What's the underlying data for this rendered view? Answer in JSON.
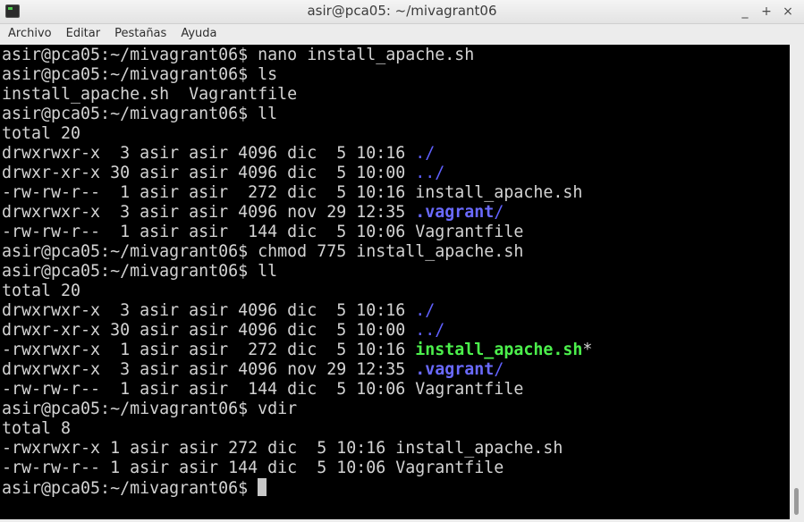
{
  "window": {
    "title": "asir@pca05: ~/mivagrant06",
    "controls": {
      "minimize": "_",
      "maximize": "+",
      "close": "×"
    }
  },
  "menu": {
    "items": [
      "Archivo",
      "Editar",
      "Pestañas",
      "Ayuda"
    ]
  },
  "terminal": {
    "lines": [
      [
        {
          "text": "asir@pca05:~/mivagrant06$ nano install_apache.sh"
        }
      ],
      [
        {
          "text": "asir@pca05:~/mivagrant06$ ls"
        }
      ],
      [
        {
          "text": "install_apache.sh  Vagrantfile"
        }
      ],
      [
        {
          "text": "asir@pca05:~/mivagrant06$ ll"
        }
      ],
      [
        {
          "text": "total 20"
        }
      ],
      [
        {
          "text": "drwxrwxr-x  3 asir asir 4096 dic  5 10:16 "
        },
        {
          "text": "./",
          "style": "blue"
        }
      ],
      [
        {
          "text": "drwxr-xr-x 30 asir asir 4096 dic  5 10:00 "
        },
        {
          "text": "../",
          "style": "blue"
        }
      ],
      [
        {
          "text": "-rw-rw-r--  1 asir asir  272 dic  5 10:16 install_apache.sh"
        }
      ],
      [
        {
          "text": "drwxrwxr-x  3 asir asir 4096 nov 29 12:35 "
        },
        {
          "text": ".vagrant",
          "style": "blue-bold"
        },
        {
          "text": "/",
          "style": "blue"
        }
      ],
      [
        {
          "text": "-rw-rw-r--  1 asir asir  144 dic  5 10:06 Vagrantfile"
        }
      ],
      [
        {
          "text": "asir@pca05:~/mivagrant06$ chmod 775 install_apache.sh"
        }
      ],
      [
        {
          "text": "asir@pca05:~/mivagrant06$ ll"
        }
      ],
      [
        {
          "text": "total 20"
        }
      ],
      [
        {
          "text": "drwxrwxr-x  3 asir asir 4096 dic  5 10:16 "
        },
        {
          "text": "./",
          "style": "blue"
        }
      ],
      [
        {
          "text": "drwxr-xr-x 30 asir asir 4096 dic  5 10:00 "
        },
        {
          "text": "../",
          "style": "blue"
        }
      ],
      [
        {
          "text": "-rwxrwxr-x  1 asir asir  272 dic  5 10:16 "
        },
        {
          "text": "install_apache.sh",
          "style": "green-bold"
        },
        {
          "text": "*"
        }
      ],
      [
        {
          "text": "drwxrwxr-x  3 asir asir 4096 nov 29 12:35 "
        },
        {
          "text": ".vagrant",
          "style": "blue-bold"
        },
        {
          "text": "/",
          "style": "blue"
        }
      ],
      [
        {
          "text": "-rw-rw-r--  1 asir asir  144 dic  5 10:06 Vagrantfile"
        }
      ],
      [
        {
          "text": "asir@pca05:~/mivagrant06$ vdir"
        }
      ],
      [
        {
          "text": "total 8"
        }
      ],
      [
        {
          "text": "-rwxrwxr-x 1 asir asir 272 dic  5 10:16 install_apache.sh"
        }
      ],
      [
        {
          "text": "-rw-rw-r-- 1 asir asir 144 dic  5 10:06 Vagrantfile"
        }
      ],
      [
        {
          "text": "asir@pca05:~/mivagrant06$ "
        }
      ]
    ]
  },
  "colors": {
    "background": "#000000",
    "foreground": "#d3d3d3",
    "directory": "#6060ff",
    "executable": "#4cf04c"
  },
  "icons": {
    "app": "terminal-icon",
    "minimize": "minimize-icon",
    "maximize": "maximize-icon",
    "close": "close-icon"
  }
}
